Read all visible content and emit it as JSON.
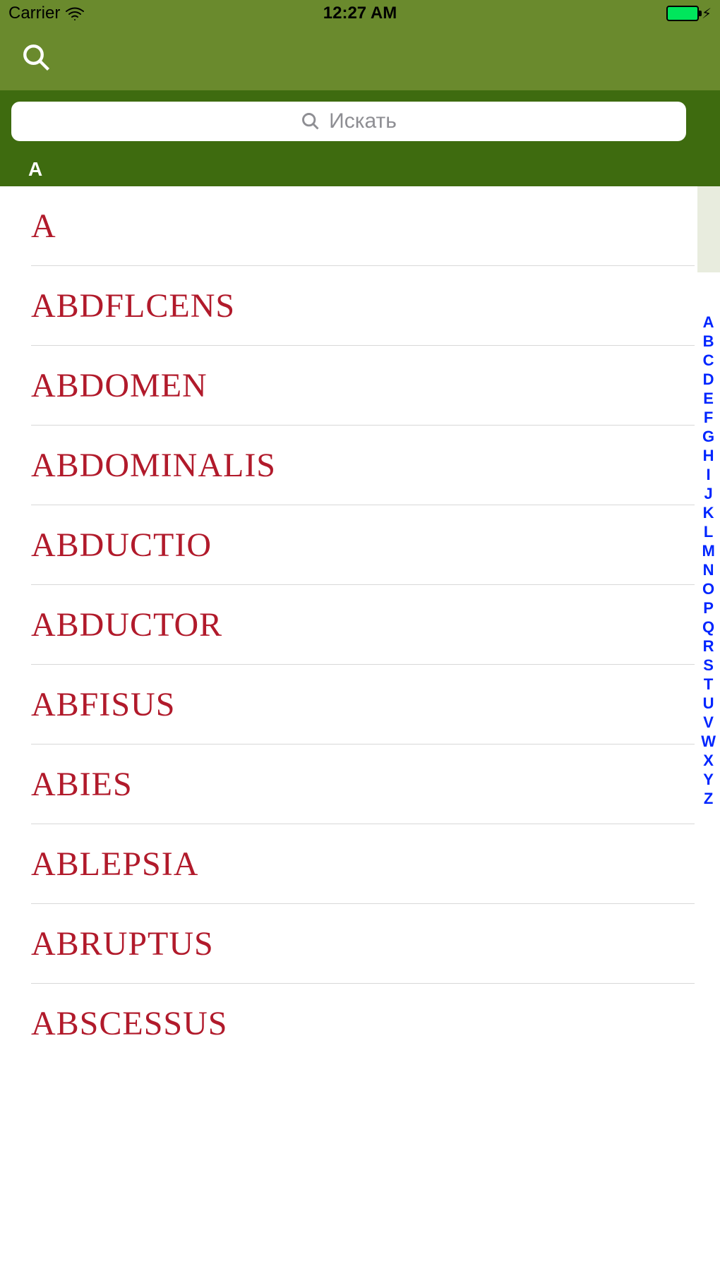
{
  "status": {
    "carrier": "Carrier",
    "time": "12:27 AM"
  },
  "search": {
    "placeholder": "Искать"
  },
  "section": {
    "header": "A"
  },
  "list": {
    "items": [
      "A",
      "ABDFLCENS",
      "ABDOMEN",
      "ABDOMINALIS",
      "ABDUCTIO",
      "ABDUCTOR",
      "ABFISUS",
      "ABIES",
      "ABLEPSIA",
      "ABRUPTUS",
      "ABSCESSUS"
    ]
  },
  "index": {
    "letters": [
      "A",
      "B",
      "C",
      "D",
      "E",
      "F",
      "G",
      "H",
      "I",
      "J",
      "K",
      "L",
      "M",
      "N",
      "O",
      "P",
      "Q",
      "R",
      "S",
      "T",
      "U",
      "V",
      "W",
      "X",
      "Y",
      "Z"
    ]
  }
}
